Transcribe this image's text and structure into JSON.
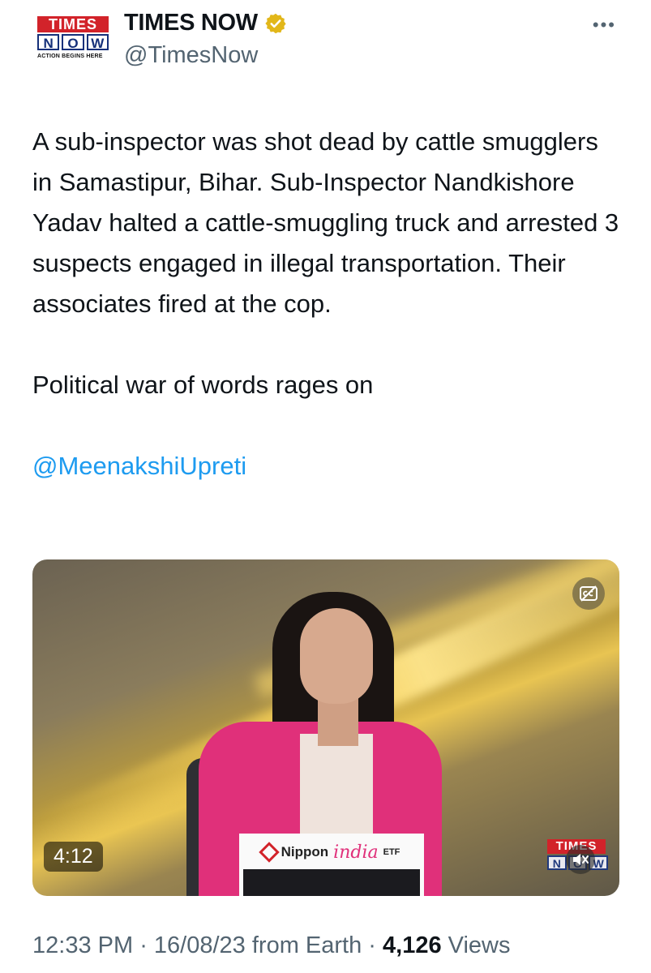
{
  "account": {
    "logo": {
      "line1": "TIMES",
      "line2": [
        "N",
        "O",
        "W"
      ],
      "tagline": "ACTION BEGINS HERE"
    },
    "display_name": "TIMES NOW",
    "verified_icon": "gold-verified-badge-icon",
    "handle": "@TimesNow",
    "more_icon": "more-options-icon",
    "more_label": "•••"
  },
  "tweet": {
    "paragraph1": "A sub-inspector was shot dead by cattle smugglers in Samastipur, Bihar. Sub-Inspector Nandkishore Yadav halted a cattle-smuggling truck and arrested 3 suspects engaged in illegal transportation. Their associates fired at the cop.",
    "paragraph2": "Political war of words rages on",
    "mention": "@MeenakshiUpreti"
  },
  "video": {
    "duration": "4:12",
    "captions_icon": "closed-captions-icon",
    "mute_icon": "speaker-muted-icon",
    "sponsor": {
      "brand": "Nippon",
      "brand2": "india",
      "suffix": "ETF"
    },
    "watermark": {
      "line1": "TIMES",
      "line2": [
        "N",
        "O",
        "W"
      ]
    }
  },
  "meta": {
    "time": "12:33 PM",
    "sep1": " · ",
    "date": "16/08/23",
    "source": " from Earth",
    "sep2": " · ",
    "views_count": "4,126",
    "views_label": " Views"
  },
  "colors": {
    "link": "#1d9bf0",
    "muted": "#536471",
    "verified": "#e2b719"
  }
}
